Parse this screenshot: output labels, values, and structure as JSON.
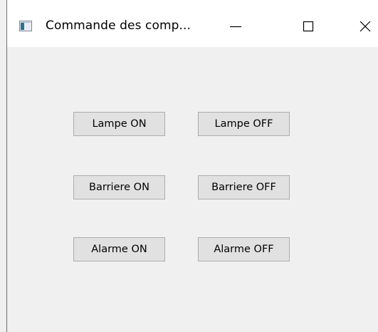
{
  "window": {
    "title": "Commande des comp..."
  },
  "title_icons": {
    "app": "app-window-icon",
    "minimize": "minimize-icon",
    "maximize": "maximize-icon",
    "close": "close-icon"
  },
  "buttons": {
    "lampe_on": "Lampe ON",
    "lampe_off": "Lampe OFF",
    "barriere_on": "Barriere ON",
    "barriere_off": "Barriere OFF",
    "alarme_on": "Alarme ON",
    "alarme_off": "Alarme OFF"
  },
  "colors": {
    "client_background": "#f0f0f0",
    "titlebar_background": "#ffffff",
    "button_face": "#e1e1e1",
    "button_border": "#adadad"
  }
}
